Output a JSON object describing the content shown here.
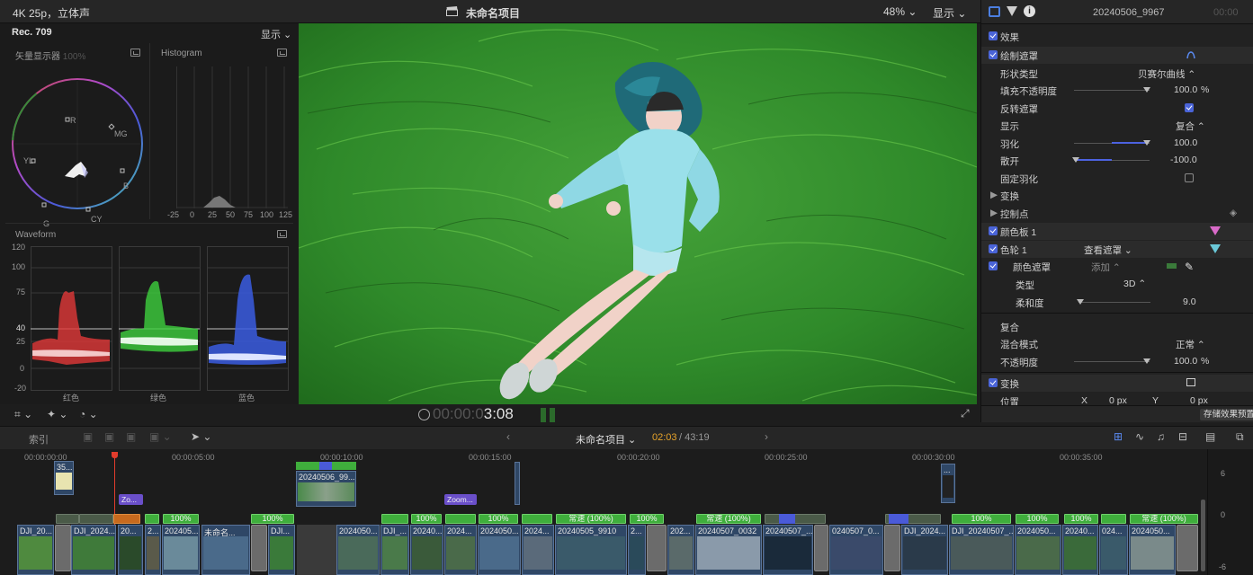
{
  "topbar": {
    "format": "4K 25p，立体声",
    "project_title": "未命名项目",
    "zoom": "48%",
    "view_menu": "显示",
    "clip_name": "20240506_9967",
    "timecode_ghost": "00:00"
  },
  "scopes": {
    "standard": "Rec. 709",
    "view_menu": "显示",
    "vectorscope": {
      "title": "矢量显示器",
      "percent": "100%",
      "targets": [
        "R",
        "MG",
        "B",
        "CY",
        "G",
        "YL"
      ]
    },
    "histogram": {
      "title": "Histogram",
      "ticks": [
        "-25",
        "0",
        "25",
        "50",
        "75",
        "100",
        "125"
      ]
    },
    "waveform": {
      "title": "Waveform",
      "scale": [
        "120",
        "100",
        "75",
        "40",
        "25",
        "0",
        "-20"
      ],
      "channels": [
        "红色",
        "绿色",
        "蓝色"
      ]
    }
  },
  "viewer": {
    "timecode_dim": "00:00:0",
    "timecode_bright": "3:08"
  },
  "inspector": {
    "rows": {
      "effects": "效果",
      "draw_mask": "绘制遮罩",
      "shape_type": "形状类型",
      "shape_type_value": "贝赛尔曲线",
      "fill_opacity": "填充不透明度",
      "fill_opacity_value": "100.0",
      "fill_opacity_unit": "%",
      "invert_mask": "反转遮罩",
      "display": "显示",
      "display_value": "复合",
      "feather": "羽化",
      "feather_value": "100.0",
      "spread": "散开",
      "spread_value": "-100.0",
      "fixed_feather": "固定羽化",
      "transform_sub": "变换",
      "control_points": "控制点",
      "color_board": "颜色板 1",
      "color_wheels": "色轮 1",
      "view_mask": "查看遮罩",
      "color_mask": "颜色遮罩",
      "add": "添加",
      "type": "类型",
      "type_value": "3D",
      "softness": "柔和度",
      "softness_value": "9.0",
      "composite": "复合",
      "blend_mode": "混合模式",
      "blend_mode_value": "正常",
      "opacity": "不透明度",
      "opacity_value": "100.0",
      "opacity_unit": "%",
      "transform": "变换",
      "position": "位置",
      "pos_x_label": "X",
      "pos_x_value": "0 px",
      "pos_y_label": "Y",
      "pos_y_value": "0 px"
    },
    "save_preset": "存储效果预置"
  },
  "timeline_bar": {
    "index": "索引",
    "project": "未命名项目",
    "time_current": "02:03",
    "time_total": "/ 43:19"
  },
  "timeline": {
    "ruler": [
      "00:00:00:00",
      "00:00:05:00",
      "00:00:10:00",
      "00:00:15:00",
      "00:00:20:00",
      "00:00:25:00",
      "00:00:30:00",
      "00:00:35:00"
    ],
    "meter": [
      "6",
      "0",
      "-6"
    ],
    "connected": [
      {
        "name": "35..."
      },
      {
        "name": "20240506_99..."
      },
      {
        "name": "..."
      }
    ],
    "titles": [
      "Zo...",
      "Zoom..."
    ],
    "speed_labels": [
      "100%",
      "100%",
      "100%",
      "100%",
      "100%",
      "常速 (100%)",
      "100%",
      "常速 (100%)",
      "100%",
      "100%",
      "100%",
      "常速 (100%)"
    ],
    "clips": [
      "DJI_20...",
      "DJI_2024...",
      "20...",
      "2...",
      "202405...",
      "未命名...",
      "DJI...",
      "2024050...",
      "DJI_...",
      "20240...",
      "2024...",
      "2024050...",
      "2024...",
      "20240505_9910",
      "2...",
      "202...",
      "20240507_0032",
      "20240507_...",
      "0240507_0...",
      "DJI_2024...",
      "DJI_20240507_...",
      "2024050...",
      "20240...",
      "024...",
      "2024050..."
    ]
  }
}
